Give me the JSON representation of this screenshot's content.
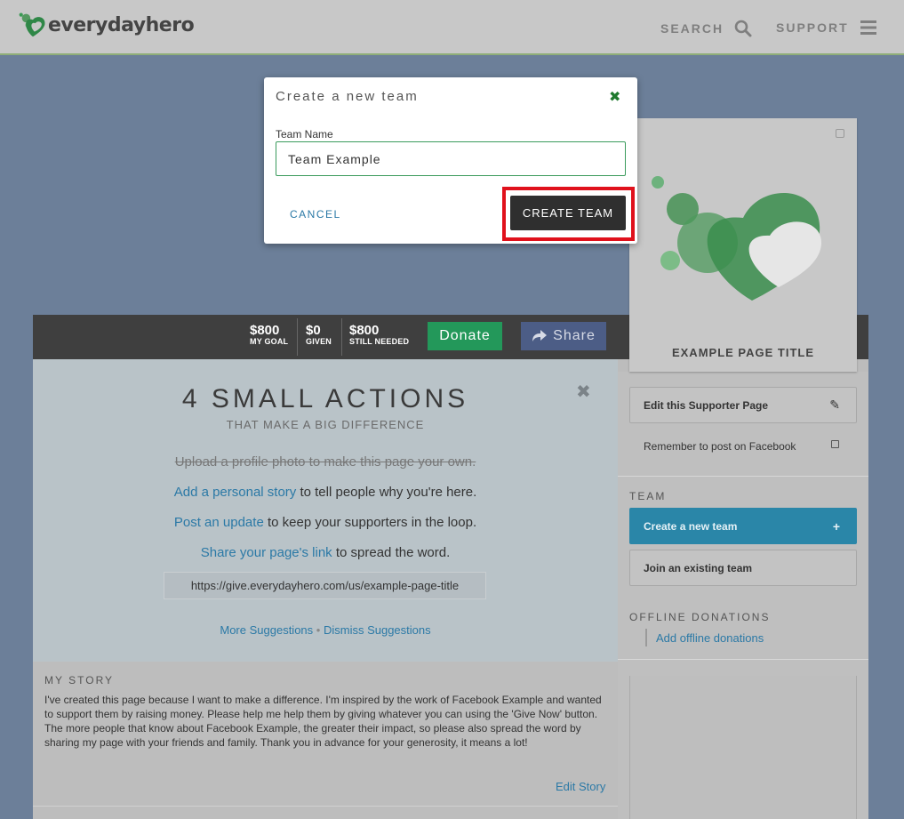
{
  "header": {
    "logo_text": "everydayhero",
    "search_label": "SEARCH",
    "support_label": "SUPPORT"
  },
  "stats": {
    "goal_value": "$800",
    "goal_label": "MY GOAL",
    "given_value": "$0",
    "given_label": "GIVEN",
    "needed_value": "$800",
    "needed_label": "STILL NEEDED",
    "donate_label": "Donate",
    "share_label": "Share"
  },
  "actions": {
    "title": "4 SMALL ACTIONS",
    "subtitle": "THAT MAKE A BIG DIFFERENCE",
    "item1": "Upload a profile photo to make this page your own.",
    "item2_link": "Add a personal story",
    "item2_rest": " to tell people why you're here.",
    "item3_link": "Post an update",
    "item3_rest": " to keep your supporters in the loop.",
    "item4_link": "Share your page's link",
    "item4_rest": " to spread the word.",
    "page_url": "https://give.everydayhero.com/us/example-page-title",
    "more_suggestions": "More Suggestions",
    "separator": "•",
    "dismiss_suggestions": "Dismiss Suggestions"
  },
  "story": {
    "heading": "MY STORY",
    "text": "I've created this page because I want to make a difference. I'm inspired by the work of Facebook Example and wanted to support them by raising money. Please help me help them by giving whatever you can using the 'Give Now' button. The more people that know about Facebook Example, the greater their impact, so please also spread the word by sharing my page with your friends and family. Thank you in advance for your generosity, it means a lot!",
    "edit_label": "Edit Story"
  },
  "sidebar": {
    "page_title": "EXAMPLE PAGE TITLE",
    "edit_page_label": "Edit this Supporter Page",
    "remember_label": "Remember to post on Facebook",
    "team_heading": "TEAM",
    "create_team_label": "Create a new team",
    "join_team_label": "Join an existing team",
    "offline_heading": "OFFLINE DONATIONS",
    "offline_link": "Add offline donations"
  },
  "modal": {
    "title": "Create a new team",
    "close_symbol": "✖",
    "field_label": "Team Name",
    "field_value": "Team Example",
    "cancel_label": "CANCEL",
    "create_label": "CREATE TEAM"
  },
  "colors": {
    "accent_green": "#23985a",
    "link_blue": "#2b79a6",
    "team_blue": "#2a86a8",
    "highlight_red": "#e0111c"
  }
}
